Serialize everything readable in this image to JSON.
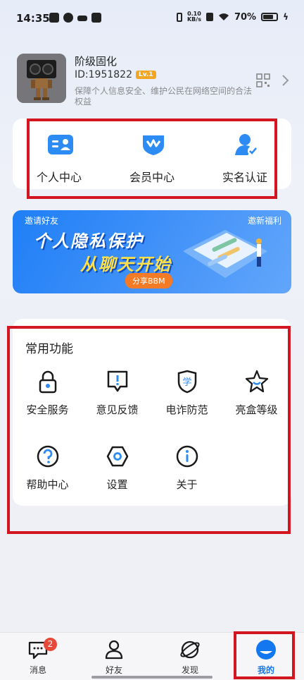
{
  "status_bar": {
    "time": "14:35",
    "net_speed_value": "0.10",
    "net_speed_unit": "KB/s",
    "battery": "70%"
  },
  "profile": {
    "name": "阶级固化",
    "id": "ID:1951822",
    "level": "Lv.1",
    "description": "保障个人信息安全、维护公民在网络空间的合法权益"
  },
  "quick_actions": [
    {
      "label": "个人中心",
      "icon": "id-card-icon"
    },
    {
      "label": "会员中心",
      "icon": "crown-badge-icon"
    },
    {
      "label": "实名认证",
      "icon": "user-verified-icon"
    }
  ],
  "banner": {
    "top_left": "邀请好友",
    "top_right": "邀新福利",
    "headline1": "个人隐私保护",
    "headline2": "从聊天开始",
    "button": "分享BBM"
  },
  "common_functions": {
    "title": "常用功能",
    "items": [
      {
        "label": "安全服务",
        "icon": "lock-icon"
      },
      {
        "label": "意见反馈",
        "icon": "feedback-icon"
      },
      {
        "label": "电诈防范",
        "icon": "shield-icon"
      },
      {
        "label": "亮盒等级",
        "icon": "star-icon"
      },
      {
        "label": "帮助中心",
        "icon": "help-icon"
      },
      {
        "label": "设置",
        "icon": "settings-icon"
      },
      {
        "label": "关于",
        "icon": "info-icon"
      }
    ]
  },
  "tab_bar": {
    "tabs": [
      {
        "label": "消息",
        "badge": "2"
      },
      {
        "label": "好友"
      },
      {
        "label": "发现"
      },
      {
        "label": "我的"
      }
    ],
    "active": "我的"
  },
  "colors": {
    "accent": "#1377f0",
    "highlight_box": "#d2151e"
  }
}
